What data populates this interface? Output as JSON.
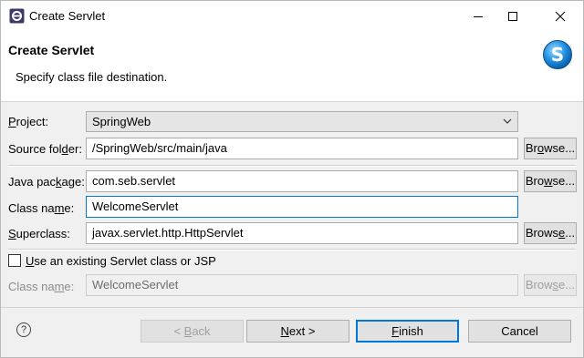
{
  "window": {
    "title": "Create Servlet",
    "controls": {
      "minimize": "minimize-icon",
      "maximize": "maximize-icon",
      "close": "close-icon"
    }
  },
  "banner": {
    "title": "Create Servlet",
    "description": "Specify class file destination."
  },
  "form": {
    "project": {
      "label_pre": "",
      "label_u": "P",
      "label_post": "roject:",
      "value": "SpringWeb"
    },
    "source_folder": {
      "label_pre": "Source fol",
      "label_u": "d",
      "label_post": "er:",
      "value": "/SpringWeb/src/main/java",
      "browse": {
        "pre": "Br",
        "u": "o",
        "post": "wse..."
      }
    },
    "java_package": {
      "label_pre": "Java pac",
      "label_u": "k",
      "label_post": "age:",
      "value": "com.seb.servlet",
      "browse": {
        "pre": "Bro",
        "u": "w",
        "post": "se..."
      }
    },
    "class_name": {
      "label_pre": "Class na",
      "label_u": "m",
      "label_post": "e:",
      "value": "WelcomeServlet"
    },
    "superclass": {
      "label_pre": "",
      "label_u": "S",
      "label_post": "uperclass:",
      "value": "javax.servlet.http.HttpServlet",
      "browse": {
        "pre": "Brows",
        "u": "e",
        "post": "..."
      }
    },
    "use_existing": {
      "label_pre": "",
      "label_u": "U",
      "label_post": "se an existing Servlet class or JSP",
      "checked": false
    },
    "existing_class_name": {
      "label_pre": "Class na",
      "label_u": "m",
      "label_post": "e:",
      "value": "WelcomeServlet",
      "browse": {
        "pre": "Brow",
        "u": "s",
        "post": "e..."
      }
    }
  },
  "footer": {
    "help": "?",
    "back": {
      "pre": "< ",
      "u": "B",
      "post": "ack"
    },
    "next": {
      "pre": "",
      "u": "N",
      "post": "ext >"
    },
    "finish": {
      "pre": "",
      "u": "F",
      "post": "inish"
    },
    "cancel": "Cancel"
  },
  "colors": {
    "accent": "#0078d7",
    "banner_bg": "#ffffff",
    "dialog_bg": "#f0f0f0"
  }
}
